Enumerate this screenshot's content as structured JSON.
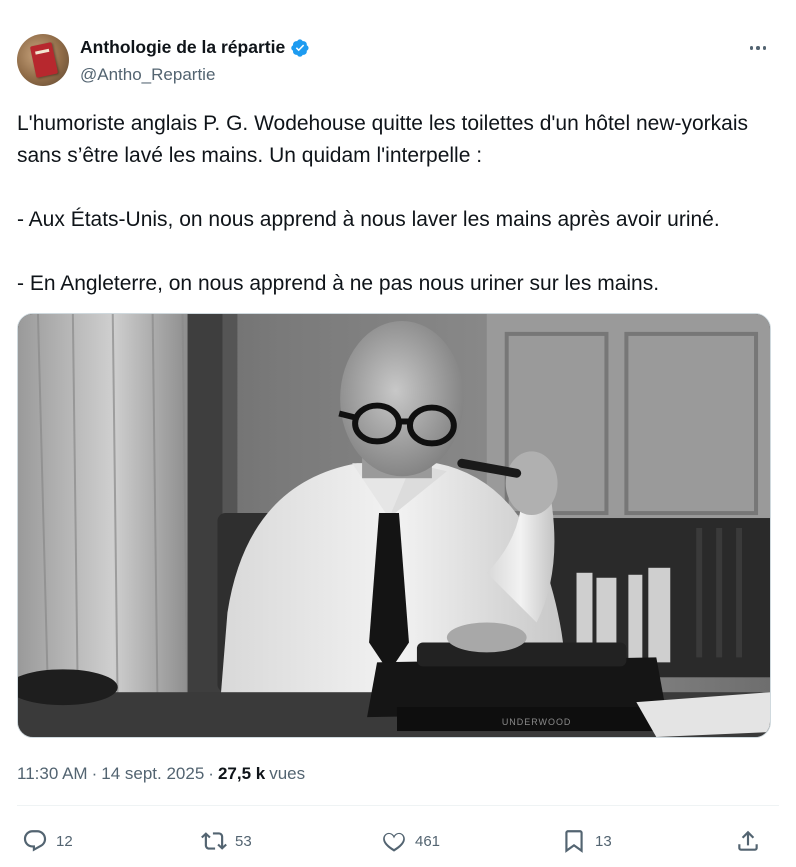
{
  "author": {
    "display_name": "Anthologie de la répartie",
    "handle": "@Antho_Repartie",
    "verified": true,
    "avatar_icon": "avatar-book-icon"
  },
  "tweet": {
    "text": "L'humoriste anglais P. G. Wodehouse quitte les toilettes d'un hôtel new-yorkais sans s’être lavé les mains. Un quidam l'interpelle :\n\n- Aux États-Unis, on nous apprend à nous laver les mains après avoir uriné.\n\n- En Angleterre, on nous apprend à ne pas nous uriner sur les mains."
  },
  "photo": {
    "typewriter_brand": "UNDERWOOD"
  },
  "meta": {
    "time": "11:30 AM",
    "separator": "·",
    "date": "14 sept. 2025",
    "views_count": "27,5 k",
    "views_label": "vues"
  },
  "actions": {
    "replies": "12",
    "retweets": "53",
    "likes": "461",
    "bookmarks": "13"
  },
  "colors": {
    "text_primary": "#0f1419",
    "text_secondary": "#536471",
    "verified_blue": "#1d9bf0",
    "divider": "#eff3f4"
  }
}
